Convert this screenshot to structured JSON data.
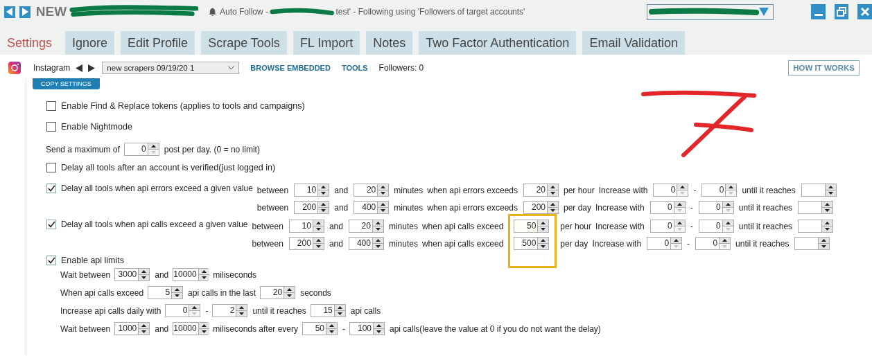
{
  "window": {
    "title": "NEW",
    "status_prefix": "Auto Follow -",
    "status_suffix": "test' - Following using 'Followers of target accounts'"
  },
  "tabs": [
    {
      "label": "Settings",
      "selected": true
    },
    {
      "label": "Ignore",
      "selected": false
    },
    {
      "label": "Edit Profile",
      "selected": false
    },
    {
      "label": "Scrape Tools",
      "selected": false
    },
    {
      "label": "FL Import",
      "selected": false
    },
    {
      "label": "Notes",
      "selected": false
    },
    {
      "label": "Two Factor Authentication",
      "selected": false
    },
    {
      "label": "Email Validation",
      "selected": false
    }
  ],
  "toolbar": {
    "network": "Instagram",
    "profile": "new scrapers 09/19/20 1",
    "links": [
      "BROWSE EMBEDDED",
      "TOOLS"
    ],
    "followers": "Followers: 0",
    "help": "HOW IT WORKS"
  },
  "copy_button": "COPY SETTINGS",
  "settings": [
    {
      "kind": "checkbox",
      "label": "Enable Find & Replace tokens (applies to tools and campaigns)",
      "checked": false
    },
    {
      "kind": "checkbox",
      "label": "Enable Nightmode",
      "checked": false
    },
    {
      "kind": "line",
      "parts": [
        {
          "kind": "text",
          "text": "Send a maximum of"
        },
        {
          "kind": "spin",
          "value": "0",
          "down_disabled": true
        },
        {
          "kind": "text",
          "text": "post per day. (0 = no limit)"
        }
      ]
    },
    {
      "kind": "checkbox",
      "label": "Delay all tools after an account is verified(just logged in)",
      "checked": false
    },
    {
      "kind": "group",
      "label": "Delay all tools when api errors exceed a given value",
      "checked": true,
      "lines": [
        [
          {
            "kind": "text",
            "text": "between"
          },
          {
            "kind": "spin",
            "value": "10",
            "down_disabled": false,
            "highlighted": false
          },
          {
            "kind": "text",
            "text": "and"
          },
          {
            "kind": "spin",
            "value": "20",
            "down_disabled": false,
            "highlighted": false
          },
          {
            "kind": "text",
            "text": "minutes"
          },
          {
            "kind": "text",
            "text": "when api errors exceeds"
          },
          {
            "kind": "spin",
            "value": "20",
            "down_disabled": false,
            "highlighted": false
          },
          {
            "kind": "text",
            "text": "per hour"
          },
          {
            "kind": "text",
            "text": "Increase with"
          },
          {
            "kind": "spin",
            "value": "0",
            "down_disabled": true,
            "highlighted": false
          },
          {
            "kind": "text",
            "text": "-"
          },
          {
            "kind": "spin",
            "value": "0",
            "down_disabled": true,
            "highlighted": false
          },
          {
            "kind": "text",
            "text": "until it reaches"
          },
          {
            "kind": "spin",
            "down_disabled": false,
            "highlighted": false
          }
        ],
        [
          {
            "kind": "text",
            "text": "between"
          },
          {
            "kind": "spin",
            "value": "200",
            "down_disabled": false,
            "highlighted": false
          },
          {
            "kind": "text",
            "text": "and"
          },
          {
            "kind": "spin",
            "value": "400",
            "down_disabled": false,
            "highlighted": false
          },
          {
            "kind": "text",
            "text": "minutes"
          },
          {
            "kind": "text",
            "text": "when api errors exceeds"
          },
          {
            "kind": "spin",
            "value": "200",
            "down_disabled": false,
            "highlighted": false
          },
          {
            "kind": "text",
            "text": "per day"
          },
          {
            "kind": "text",
            "text": "Increase with"
          },
          {
            "kind": "spin",
            "value": "0",
            "down_disabled": true,
            "highlighted": false
          },
          {
            "kind": "text",
            "text": "-"
          },
          {
            "kind": "spin",
            "value": "0",
            "down_disabled": true,
            "highlighted": false
          },
          {
            "kind": "text",
            "text": "until it reaches"
          },
          {
            "kind": "spin",
            "down_disabled": false,
            "highlighted": false
          }
        ]
      ]
    },
    {
      "kind": "group",
      "label": "Delay all tools when api calls exceed a given value",
      "checked": true,
      "lines": [
        [
          {
            "kind": "text",
            "text": "between"
          },
          {
            "kind": "spin",
            "value": "10",
            "down_disabled": false,
            "highlighted": false
          },
          {
            "kind": "text",
            "text": "and"
          },
          {
            "kind": "spin",
            "value": "20",
            "down_disabled": false,
            "highlighted": false
          },
          {
            "kind": "text",
            "text": "minutes"
          },
          {
            "kind": "text",
            "text": "when api calls exceed"
          },
          {
            "kind": "spin",
            "value": "50",
            "down_disabled": false,
            "highlighted": true
          },
          {
            "kind": "text",
            "text": "per hour"
          },
          {
            "kind": "text",
            "text": "Increase with"
          },
          {
            "kind": "spin",
            "value": "0",
            "down_disabled": true,
            "highlighted": false
          },
          {
            "kind": "text",
            "text": "-"
          },
          {
            "kind": "spin",
            "value": "0",
            "down_disabled": true,
            "highlighted": false
          },
          {
            "kind": "text",
            "text": "until it reaches"
          },
          {
            "kind": "spin",
            "down_disabled": false,
            "highlighted": false
          }
        ],
        [
          {
            "kind": "text",
            "text": "between"
          },
          {
            "kind": "spin",
            "value": "200",
            "down_disabled": false,
            "highlighted": false
          },
          {
            "kind": "text",
            "text": "and"
          },
          {
            "kind": "spin",
            "value": "400",
            "down_disabled": false,
            "highlighted": false
          },
          {
            "kind": "text",
            "text": "minutes"
          },
          {
            "kind": "text",
            "text": "when api calls exceed"
          },
          {
            "kind": "spin",
            "value": "500",
            "down_disabled": false,
            "highlighted": false
          },
          {
            "kind": "text",
            "text": "per day"
          },
          {
            "kind": "text",
            "text": "Increase with"
          },
          {
            "kind": "spin",
            "value": "0",
            "down_disabled": true,
            "highlighted": false
          },
          {
            "kind": "text",
            "text": "-"
          },
          {
            "kind": "spin",
            "value": "0",
            "down_disabled": true,
            "highlighted": false
          },
          {
            "kind": "text",
            "text": "until it reaches"
          },
          {
            "kind": "spin",
            "down_disabled": false,
            "highlighted": false
          }
        ]
      ]
    },
    {
      "kind": "block",
      "label": "Enable api limits",
      "checked": true,
      "lines": [
        [
          {
            "kind": "text",
            "text": "Wait between"
          },
          {
            "kind": "spin",
            "value": "3000",
            "down_disabled": false
          },
          {
            "kind": "text",
            "text": "and"
          },
          {
            "kind": "spin",
            "value": "10000",
            "down_disabled": false
          },
          {
            "kind": "text",
            "text": "miliseconds"
          }
        ],
        [
          {
            "kind": "text",
            "text": "When api calls exceed"
          },
          {
            "kind": "spin",
            "value": "5",
            "down_disabled": false
          },
          {
            "kind": "text",
            "text": "api calls in the last"
          },
          {
            "kind": "spin",
            "value": "20",
            "down_disabled": false
          },
          {
            "kind": "text",
            "text": "seconds"
          }
        ],
        [
          {
            "kind": "text",
            "text": "Increase api calls daily with"
          },
          {
            "kind": "spin",
            "value": "0",
            "down_disabled": true
          },
          {
            "kind": "text",
            "text": "-"
          },
          {
            "kind": "spin",
            "value": "2",
            "down_disabled": false
          },
          {
            "kind": "text",
            "text": "until it reaches"
          },
          {
            "kind": "spin",
            "value": "15",
            "down_disabled": false
          },
          {
            "kind": "text",
            "text": "api calls"
          }
        ],
        [
          {
            "kind": "text",
            "text": "Wait between"
          },
          {
            "kind": "spin",
            "value": "1000",
            "down_disabled": false
          },
          {
            "kind": "text",
            "text": "and"
          },
          {
            "kind": "spin",
            "value": "10000",
            "down_disabled": false
          },
          {
            "kind": "text",
            "text": "miliseconds after every"
          },
          {
            "kind": "spin",
            "value": "50",
            "down_disabled": false
          },
          {
            "kind": "text",
            "text": "-"
          },
          {
            "kind": "spin",
            "value": "100",
            "down_disabled": false
          },
          {
            "kind": "text",
            "text": "api calls(leave the value at 0 if you do not want the delay)"
          }
        ]
      ]
    }
  ]
}
